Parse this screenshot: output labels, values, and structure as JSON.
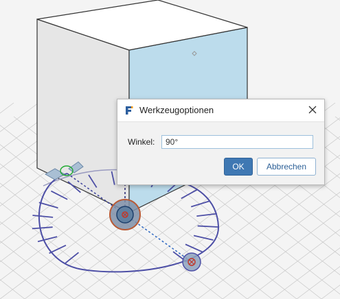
{
  "scene": {
    "background": "#f4f4f4",
    "grid_color": "#c8c8c8",
    "cube_top_color": "#ffffff",
    "cube_left_color": "#e6e6e6",
    "cube_right_color": "#bcdcec",
    "cube_edge_color": "#333333",
    "gizmo_color": "#4d4fa6",
    "hotspot_fill": "#7f8fa8",
    "hotspot_outline": "#b85a36",
    "start_handle_color": "#22aa33",
    "tick_count": 20
  },
  "dialog": {
    "title": "Werkzeugoptionen",
    "app_icon": "fusion-logo-icon",
    "close_icon": "close-icon",
    "angle_label": "Winkel:",
    "angle_value": "90°",
    "ok_label": "OK",
    "cancel_label": "Abbrechen",
    "accent_color": "#3f78b3"
  }
}
